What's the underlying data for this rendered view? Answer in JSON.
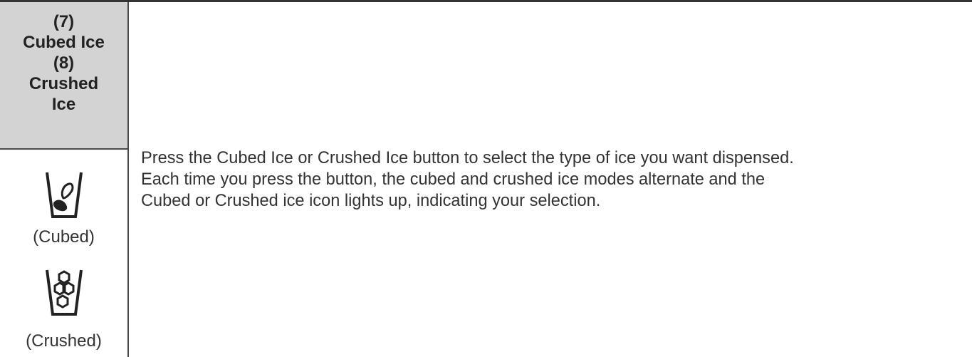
{
  "header": {
    "line1": "(7)",
    "line2": "Cubed Ice",
    "line3": "(8)",
    "line4": "Crushed",
    "line5": "Ice"
  },
  "icons": {
    "cubed_icon": "cubed-ice-cup-icon",
    "crushed_icon": "crushed-ice-cup-icon",
    "cubed_caption": "(Cubed)",
    "crushed_caption": "(Crushed)"
  },
  "description": {
    "line1": "Press the Cubed Ice or Crushed Ice button to select the type of ice you want dispensed.",
    "line2": "Each time you press the button, the cubed and crushed ice modes alternate and the",
    "line3": "Cubed or Crushed ice icon lights up, indicating your selection."
  },
  "colors": {
    "header_background": "#d3d3d3",
    "border": "#4a4a4a",
    "text": "#333333"
  }
}
